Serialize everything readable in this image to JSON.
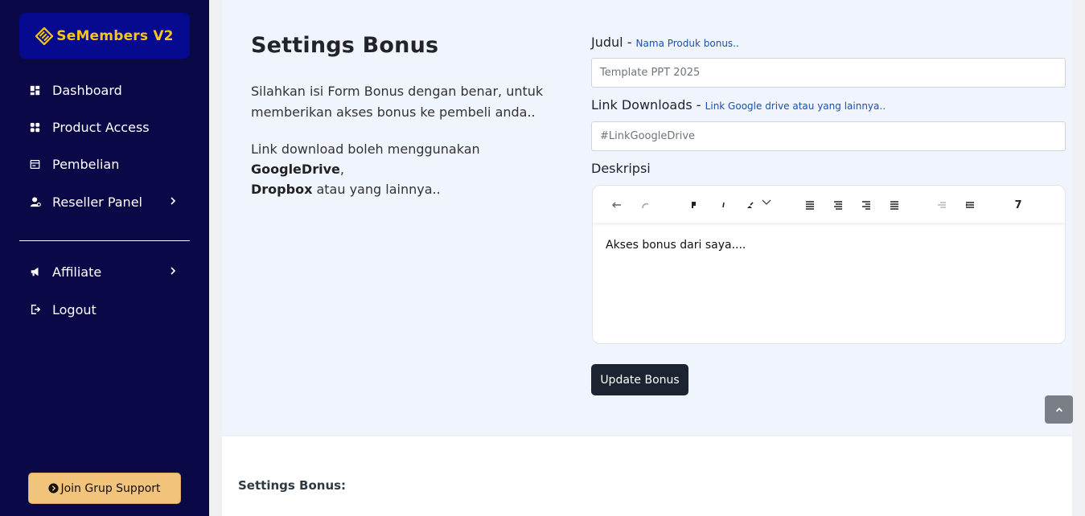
{
  "sidebar": {
    "brand": "SeMembers V2",
    "items": [
      {
        "label": "Dashboard",
        "icon": "dashboard-icon"
      },
      {
        "label": "Product Access",
        "icon": "grid-icon"
      },
      {
        "label": "Pembelian",
        "icon": "receipt-icon"
      },
      {
        "label": "Reseller Panel",
        "icon": "user-gear-icon"
      },
      {
        "label": "Affiliate",
        "icon": "megaphone-icon"
      },
      {
        "label": "Logout",
        "icon": "logout-icon"
      }
    ],
    "support_button": "Join Grup Support"
  },
  "page": {
    "title": "Settings Bonus",
    "description": "Silahkan isi Form Bonus dengan benar, untuk memberikan akses bonus ke pembeli anda..",
    "link_text_prefix": "Link download boleh menggunakan ",
    "link_text_gdrive": "GoogleDrive",
    "link_text_comma": ",",
    "link_text_dropbox": "Dropbox",
    "link_text_suffix": " atau yang lainnya.."
  },
  "form": {
    "judul_label": "Judul - ",
    "judul_hint": "Nama Produk bonus..",
    "judul_placeholder": "Template PPT 2025",
    "link_label": "Link Downloads - ",
    "link_hint": "Link Google drive atau yang lainnya..",
    "link_placeholder": "#LinkGoogleDrive",
    "deskripsi_label": "Deskripsi",
    "editor_content": "Akses bonus dari saya....",
    "toolbar_heading": "7",
    "update_button": "Update Bonus"
  },
  "section_bottom_title": "Settings Bonus:",
  "colors": {
    "sidebar_bg": "#0b0848",
    "brand_bg": "#050a8f",
    "brand_text": "#f5c518",
    "support_bg": "#f2c37a",
    "button_dark": "#1c2431",
    "hint_blue": "#1a4fb4"
  }
}
